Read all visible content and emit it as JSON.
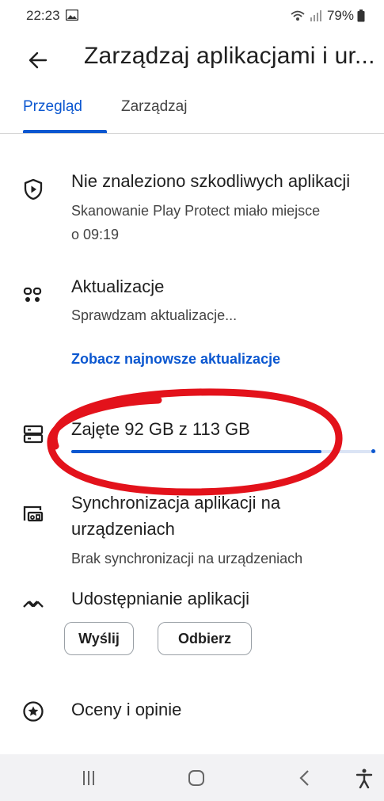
{
  "status_bar": {
    "time": "22:23",
    "battery": "79%",
    "icons": [
      "gallery-icon",
      "wifi-calling-icon",
      "signal-icon",
      "battery-icon"
    ]
  },
  "header": {
    "title": "Zarządzaj aplikacjami i ur...",
    "back_icon": "arrow-back-icon"
  },
  "tabs": [
    {
      "label": "Przegląd",
      "active": true
    },
    {
      "label": "Zarządzaj",
      "active": false
    }
  ],
  "protect": {
    "icon": "shield-play-icon",
    "title": "Nie znaleziono szkodliwych aplikacji",
    "subtitle_line1": "Skanowanie Play Protect miało miejsce",
    "subtitle_line2": "o 09:19"
  },
  "updates": {
    "icon": "apps-grid-icon",
    "title": "Aktualizacje",
    "subtitle": "Sprawdzam aktualizacje...",
    "link": "Zobacz najnowsze aktualizacje"
  },
  "storage": {
    "icon": "storage-icon",
    "label": "Zajęte 92 GB z 113 GB",
    "used_fraction": 0.82,
    "annotation": "red-circle-highlight"
  },
  "sync": {
    "icon": "device-sync-icon",
    "title_line1": "Synchronizacja aplikacji na",
    "title_line2": "urządzeniach",
    "subtitle": "Brak synchronizacji na urządzeniach"
  },
  "sharing": {
    "icon": "share-arrows-icon",
    "title": "Udostępnianie aplikacji",
    "send_label": "Wyślij",
    "receive_label": "Odbierz"
  },
  "ratings": {
    "icon": "star-circle-icon",
    "title": "Oceny i opinie"
  },
  "nav_bar": {
    "items": [
      "recents-icon",
      "home-icon",
      "back-icon",
      "accessibility-icon"
    ]
  },
  "colors": {
    "accent": "#0b57d0",
    "annotation_red": "#e3121b",
    "nav_background": "#f2f2f4"
  }
}
